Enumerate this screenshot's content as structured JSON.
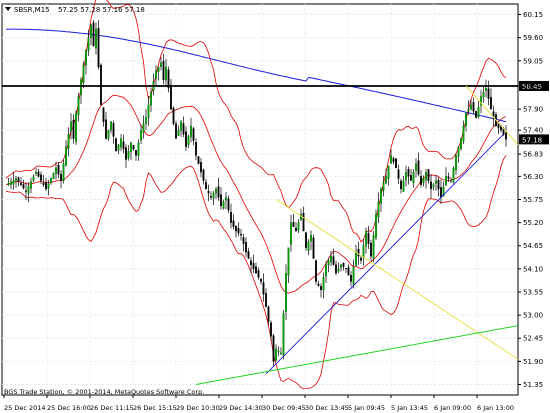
{
  "chart_data": {
    "type": "candlestick",
    "symbol_header": "SBSR,M15",
    "ohlc_header": "57.25 57.28 57.16 57.18",
    "watermark": "BGS Trade Station, © 2001-2014, MetaQuotes Software Corp.",
    "y_ticks": [
      "60.15",
      "59.60",
      "59.05",
      "58.45",
      "57.90",
      "57.40",
      "56.83",
      "56.30",
      "55.75",
      "55.20",
      "54.65",
      "54.10",
      "53.55",
      "53.00",
      "52.45",
      "51.90",
      "51.35"
    ],
    "ylim": [
      51.1,
      60.4
    ],
    "x_ticks": [
      "25 Dec 2014",
      "25 Dec 16:00",
      "26 Dec 11:15",
      "26 Dec 15:15",
      "29 Dec 10:30",
      "29 Dec 14:30",
      "30 Dec 09:45",
      "30 Dec 13:45",
      "5 Jan 09:45",
      "5 Jan 13:45",
      "6 Jan 09:00",
      "6 Jan 13:00"
    ],
    "horizontal_level": 58.45,
    "last_price": 57.18,
    "close_path": [
      [
        0,
        56.1
      ],
      [
        4,
        56.25
      ],
      [
        8,
        55.95
      ],
      [
        12,
        56.4
      ],
      [
        16,
        56.0
      ],
      [
        20,
        56.5
      ],
      [
        22,
        56.2
      ],
      [
        24,
        57.0
      ],
      [
        26,
        57.6
      ],
      [
        27,
        57.2
      ],
      [
        28,
        57.8
      ],
      [
        30,
        58.6
      ],
      [
        32,
        59.3
      ],
      [
        34,
        59.9
      ],
      [
        35,
        59.4
      ],
      [
        36,
        59.8
      ],
      [
        38,
        58.0
      ],
      [
        40,
        57.2
      ],
      [
        42,
        57.6
      ],
      [
        44,
        56.9
      ],
      [
        46,
        57.2
      ],
      [
        48,
        56.7
      ],
      [
        50,
        57.1
      ],
      [
        52,
        56.8
      ],
      [
        54,
        57.4
      ],
      [
        56,
        57.7
      ],
      [
        58,
        58.3
      ],
      [
        60,
        58.8
      ],
      [
        62,
        59.0
      ],
      [
        63,
        58.6
      ],
      [
        64,
        58.9
      ],
      [
        66,
        57.9
      ],
      [
        68,
        57.2
      ],
      [
        70,
        57.6
      ],
      [
        72,
        57.0
      ],
      [
        74,
        57.5
      ],
      [
        76,
        56.8
      ],
      [
        78,
        56.4
      ],
      [
        80,
        56.0
      ],
      [
        82,
        55.8
      ],
      [
        84,
        56.0
      ],
      [
        86,
        55.6
      ],
      [
        88,
        55.8
      ],
      [
        90,
        55.2
      ],
      [
        92,
        55.0
      ],
      [
        94,
        54.9
      ],
      [
        96,
        54.5
      ],
      [
        98,
        54.2
      ],
      [
        100,
        54.0
      ],
      [
        102,
        53.8
      ],
      [
        104,
        53.2
      ],
      [
        106,
        52.5
      ],
      [
        107,
        51.9
      ],
      [
        108,
        52.2
      ],
      [
        110,
        52.1
      ],
      [
        112,
        54.0
      ],
      [
        114,
        55.2
      ],
      [
        116,
        55.0
      ],
      [
        118,
        55.4
      ],
      [
        120,
        54.6
      ],
      [
        122,
        54.9
      ],
      [
        124,
        53.8
      ],
      [
        126,
        53.6
      ],
      [
        128,
        54.2
      ],
      [
        130,
        54.4
      ],
      [
        132,
        54.0
      ],
      [
        134,
        54.2
      ],
      [
        136,
        54.1
      ],
      [
        138,
        53.8
      ],
      [
        140,
        54.5
      ],
      [
        142,
        54.3
      ],
      [
        144,
        55.0
      ],
      [
        146,
        54.4
      ],
      [
        148,
        55.4
      ],
      [
        150,
        56.0
      ],
      [
        152,
        56.3
      ],
      [
        154,
        56.8
      ],
      [
        156,
        56.5
      ],
      [
        158,
        56.0
      ],
      [
        160,
        56.4
      ],
      [
        162,
        56.2
      ],
      [
        164,
        56.6
      ],
      [
        166,
        56.1
      ],
      [
        168,
        56.4
      ],
      [
        170,
        56.0
      ],
      [
        172,
        56.2
      ],
      [
        174,
        55.8
      ],
      [
        176,
        56.3
      ],
      [
        178,
        56.2
      ],
      [
        180,
        56.8
      ],
      [
        182,
        57.2
      ],
      [
        184,
        57.8
      ],
      [
        186,
        58.0
      ],
      [
        188,
        57.7
      ],
      [
        190,
        58.2
      ],
      [
        192,
        58.4
      ],
      [
        194,
        57.9
      ],
      [
        196,
        57.5
      ],
      [
        198,
        57.4
      ],
      [
        200,
        57.18
      ]
    ]
  }
}
